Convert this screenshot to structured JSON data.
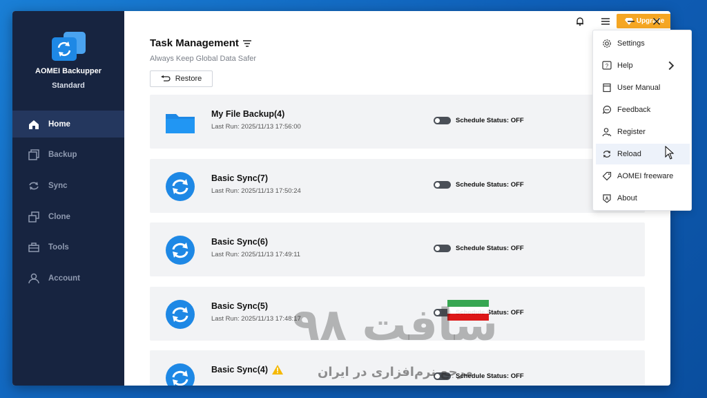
{
  "app": {
    "name": "AOMEI Backupper",
    "edition": "Standard"
  },
  "topbar": {
    "upgrade_label": "Upgrade"
  },
  "sidebar": {
    "items": [
      {
        "label": "Home",
        "icon": "home-icon",
        "active": true
      },
      {
        "label": "Backup",
        "icon": "backup-icon",
        "active": false
      },
      {
        "label": "Sync",
        "icon": "sync-icon",
        "active": false
      },
      {
        "label": "Clone",
        "icon": "clone-icon",
        "active": false
      },
      {
        "label": "Tools",
        "icon": "tools-icon",
        "active": false
      },
      {
        "label": "Account",
        "icon": "account-icon",
        "active": false
      }
    ]
  },
  "main": {
    "title": "Task Management",
    "subtitle": "Always Keep Global Data Safer",
    "restore_label": "Restore",
    "tasks": [
      {
        "name": "My File Backup(4)",
        "last_run": "Last Run: 2025/11/13 17:56:00",
        "schedule": "Schedule Status: OFF",
        "icon": "folder-icon"
      },
      {
        "name": "Basic Sync(7)",
        "last_run": "Last Run: 2025/11/13 17:50:24",
        "schedule": "Schedule Status: OFF",
        "icon": "sync-task-icon"
      },
      {
        "name": "Basic Sync(6)",
        "last_run": "Last Run: 2025/11/13 17:49:11",
        "schedule": "Schedule Status: OFF",
        "icon": "sync-task-icon"
      },
      {
        "name": "Basic Sync(5)",
        "last_run": "Last Run: 2025/11/13 17:48:17",
        "schedule": "Schedule Status: OFF",
        "icon": "sync-task-icon"
      },
      {
        "name": "Basic Sync(4)",
        "last_run": "",
        "schedule": "Schedule Status: OFF",
        "icon": "sync-task-icon",
        "warning": true
      }
    ]
  },
  "menu": {
    "items": [
      {
        "label": "Settings",
        "icon": "gear-icon"
      },
      {
        "label": "Help",
        "icon": "help-icon",
        "submenu": true
      },
      {
        "label": "User Manual",
        "icon": "manual-icon"
      },
      {
        "label": "Feedback",
        "icon": "feedback-icon"
      },
      {
        "label": "Register",
        "icon": "register-icon"
      },
      {
        "label": "Reload",
        "icon": "reload-icon",
        "hovered": true
      },
      {
        "label": "AOMEI freeware",
        "icon": "tag-icon"
      },
      {
        "label": "About",
        "icon": "about-icon"
      }
    ]
  },
  "watermark": {
    "text": "سافت ۹۸",
    "tagline": "مرجع نرم‌افزاری در ایران"
  },
  "colors": {
    "sidebar_bg": "#172440",
    "sidebar_active": "#24375e",
    "accent_blue": "#1e88e5",
    "upgrade_orange": "#f5a623",
    "card_bg": "#f2f3f5"
  }
}
